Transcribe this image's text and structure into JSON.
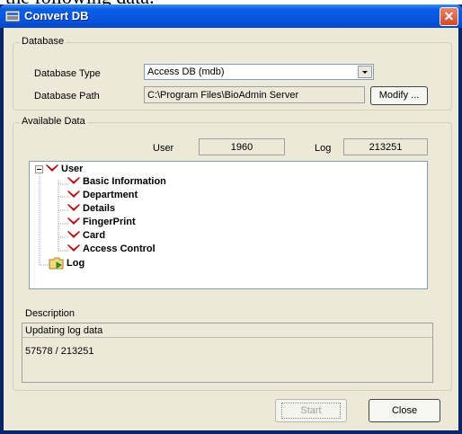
{
  "window": {
    "title": "Convert DB"
  },
  "cropped_caption": "the following data.",
  "database": {
    "legend": "Database",
    "type_label": "Database Type",
    "type_value": "Access DB (mdb)",
    "path_label": "Database Path",
    "path_value": "C:\\Program Files\\BioAdmin Server",
    "modify_label": "Modify ..."
  },
  "available": {
    "legend": "Available Data",
    "user_label": "User",
    "user_count": "1960",
    "log_label": "Log",
    "log_count": "213251",
    "tree": {
      "root": "User",
      "children": [
        "Basic Information",
        "Department",
        "Details",
        "FingerPrint",
        "Card",
        "Access Control"
      ],
      "log": "Log"
    },
    "description_label": "Description",
    "status_line": "Updating log data",
    "progress_text": "57578 / 213251"
  },
  "buttons": {
    "start": "Start",
    "close": "Close"
  },
  "colors": {
    "check": "#b01010",
    "title_bg": "#0654dd",
    "dialog_bg": "#ece9d8"
  }
}
